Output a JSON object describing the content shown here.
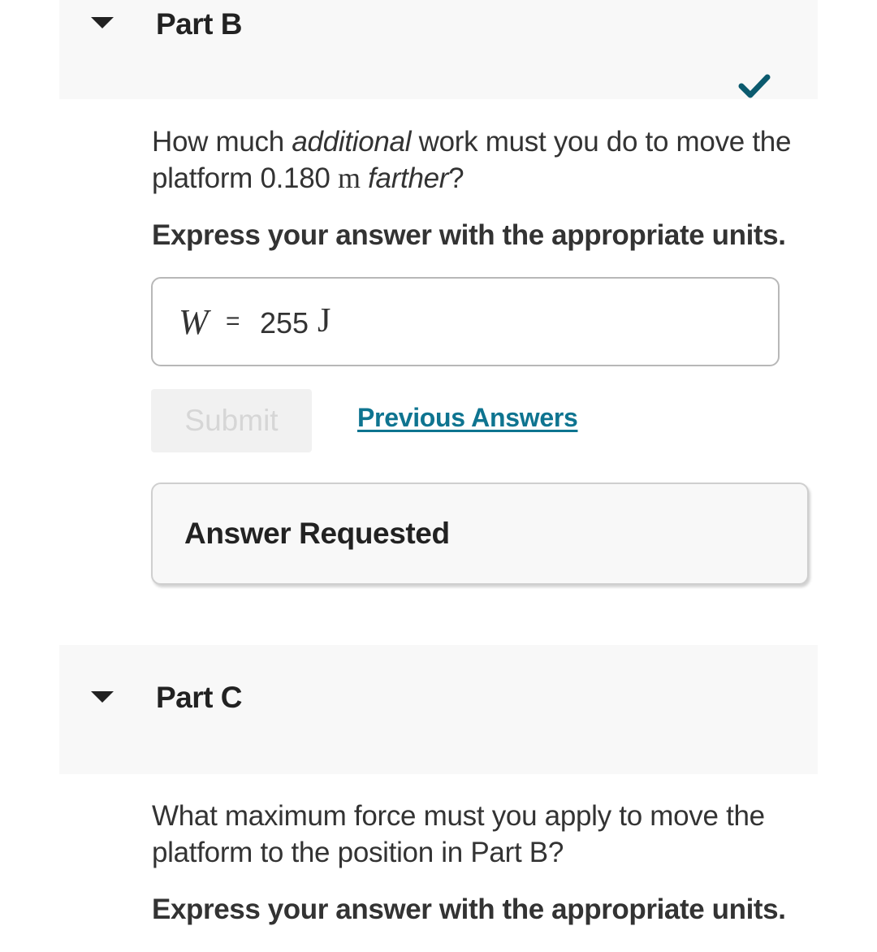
{
  "partB": {
    "title": "Part B",
    "status_icon": "checkmark-icon",
    "question": {
      "pre": "How much ",
      "em1": "additional",
      "mid": " work must you do to move the platform 0.180 ",
      "unit": "m",
      "sp": " ",
      "em2": "farther",
      "post": "?"
    },
    "instruction": "Express your answer with the appropriate units.",
    "answer": {
      "variable": "W",
      "equals": "=",
      "value": "255",
      "unit": "J"
    },
    "submit_label": "Submit",
    "previous_answers_label": "Previous Answers",
    "feedback": "Answer Requested"
  },
  "partC": {
    "title": "Part C",
    "question": "What maximum force must you apply to move the platform to the position in Part B?",
    "instruction": "Express your answer with the appropriate units."
  },
  "colors": {
    "accent": "#0e7490",
    "check": "#0b5a6e",
    "header_bg": "#f8f8f8"
  }
}
